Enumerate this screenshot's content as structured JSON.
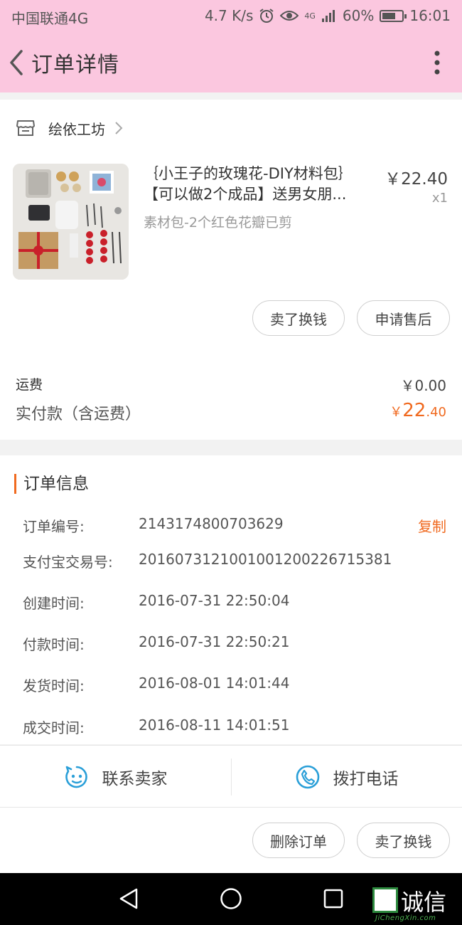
{
  "status_bar": {
    "carrier": "中国联通4G",
    "speed": "4.7 K/s",
    "network": "4G",
    "battery": "60%",
    "time": "16:01"
  },
  "header": {
    "title": "订单详情"
  },
  "shop": {
    "name": "绘依工坊"
  },
  "product": {
    "title_line1": "｛小王子的玫瑰花-DIY材料包｝",
    "title_line2": "【可以做2个成品】送男女朋...",
    "price": "￥22.40",
    "quantity": "x1",
    "sku": "素材包-2个红色花瓣已剪"
  },
  "item_actions": {
    "sell_label": "卖了换钱",
    "after_sale_label": "申请售后"
  },
  "summary": {
    "shipping_label": "运费",
    "shipping_value": "￥0.00",
    "paid_label": "实付款（含运费）",
    "paid_currency": "￥",
    "paid_int": "22",
    "paid_dec": ".40"
  },
  "order_info": {
    "title": "订单信息",
    "copy_label": "复制",
    "rows": [
      {
        "label": "订单编号:",
        "value": "2143174800703629"
      },
      {
        "label": "支付宝交易号:",
        "value": "2016073121001001200226715381"
      },
      {
        "label": "创建时间:",
        "value": "2016-07-31 22:50:04"
      },
      {
        "label": "付款时间:",
        "value": "2016-07-31 22:50:21"
      },
      {
        "label": "发货时间:",
        "value": "2016-08-01 14:01:44"
      },
      {
        "label": "成交时间:",
        "value": "2016-08-11 14:01:51"
      }
    ]
  },
  "contact": {
    "seller_label": "联系卖家",
    "phone_label": "拨打电话"
  },
  "bottom_actions": {
    "delete_label": "删除订单",
    "sell_label": "卖了换钱"
  },
  "watermark": {
    "text": "诚信",
    "sub": "JiChengXin.com"
  },
  "colors": {
    "header_bg": "#fbc7df",
    "accent": "#f06a20",
    "icon_blue": "#2a9fd8"
  }
}
